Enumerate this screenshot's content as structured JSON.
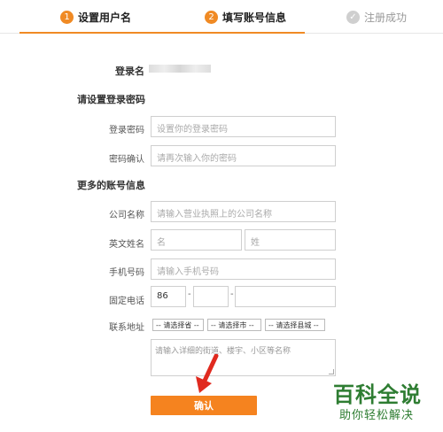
{
  "steps": [
    {
      "num": "1",
      "label": "设置用户名"
    },
    {
      "num": "2",
      "label": "填写账号信息"
    },
    {
      "num": "✓",
      "label": "注册成功"
    }
  ],
  "login": {
    "label": "登录名"
  },
  "section_password": "请设置登录密码",
  "password": {
    "label": "登录密码",
    "placeholder": "设置你的登录密码"
  },
  "confirm": {
    "label": "密码确认",
    "placeholder": "请再次输入你的密码"
  },
  "section_more": "更多的账号信息",
  "company": {
    "label": "公司名称",
    "placeholder": "请输入营业执照上的公司名称"
  },
  "english_name": {
    "label": "英文姓名",
    "first_placeholder": "名",
    "last_placeholder": "姓"
  },
  "mobile": {
    "label": "手机号码",
    "placeholder": "请输入手机号码"
  },
  "phone": {
    "label": "固定电话",
    "area_code": "86",
    "sep1": "-",
    "sep2": "-"
  },
  "address": {
    "label": "联系地址",
    "province": "-- 请选择省 --",
    "city": "-- 请选择市 --",
    "county": "-- 请选择县城 --",
    "detail_placeholder": "请输入详细的街道、楼宇、小区等名称"
  },
  "submit": {
    "label": "确认"
  },
  "watermark": {
    "title": "百科全说",
    "subtitle": "助你轻松解决"
  },
  "colors": {
    "accent": "#f08a24",
    "button": "#f5831f",
    "arrow": "#e02a1f",
    "watermark": "#2e7d32"
  }
}
